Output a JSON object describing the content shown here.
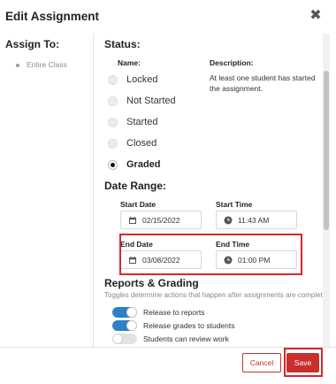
{
  "header": {
    "title": "Edit Assignment",
    "close_glyph": "✖"
  },
  "assign_to": {
    "heading": "Assign To:",
    "items": [
      {
        "label": "Entire Class"
      }
    ]
  },
  "status": {
    "heading": "Status:",
    "name_col": "Name:",
    "desc_col": "Description:",
    "description": "At least one student has started the assignment.",
    "options": [
      {
        "label": "Locked",
        "checked": false
      },
      {
        "label": "Not Started",
        "checked": false
      },
      {
        "label": "Started",
        "checked": false
      },
      {
        "label": "Closed",
        "checked": false
      },
      {
        "label": "Graded",
        "checked": true
      }
    ]
  },
  "date_range": {
    "heading": "Date Range:",
    "start_date_label": "Start Date",
    "start_date_value": "02/15/2022",
    "start_time_label": "Start Time",
    "start_time_value": "11:43 AM",
    "end_date_label": "End Date",
    "end_date_value": "03/08/2022",
    "end_time_label": "End Time",
    "end_time_value": "01:00 PM"
  },
  "reports": {
    "heading": "Reports & Grading",
    "subtitle": "Toggles determine actions that happen after assignments are complete.",
    "toggles": [
      {
        "label": "Release to reports",
        "on": true
      },
      {
        "label": "Release grades to students",
        "on": true
      },
      {
        "label": "Students can review work",
        "on": false
      }
    ]
  },
  "footer": {
    "cancel_label": "Cancel",
    "save_label": "Save"
  },
  "colors": {
    "accent_red": "#c9302c",
    "toggle_blue": "#2e7fc6",
    "highlight_red": "#d9262c"
  },
  "icons": {
    "close": "close-icon",
    "calendar": "calendar-icon",
    "clock": "clock-icon"
  }
}
